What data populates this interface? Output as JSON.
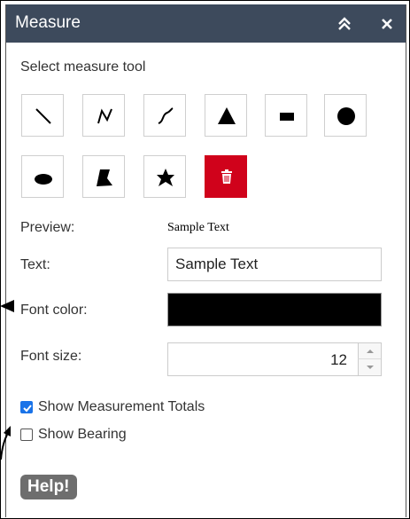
{
  "panel": {
    "title": "Measure",
    "collapse_icon": "chevron-double-up-icon",
    "close_icon": "close-icon",
    "header_color": "#3d4a5c"
  },
  "tools": {
    "label": "Select measure tool",
    "items": [
      {
        "name": "line",
        "icon": "line-icon"
      },
      {
        "name": "polyline",
        "icon": "polyline-icon"
      },
      {
        "name": "freehand-polyline",
        "icon": "freehand-line-icon"
      },
      {
        "name": "triangle",
        "icon": "triangle-icon"
      },
      {
        "name": "rectangle",
        "icon": "rectangle-icon"
      },
      {
        "name": "circle",
        "icon": "circle-icon"
      },
      {
        "name": "ellipse",
        "icon": "ellipse-icon"
      },
      {
        "name": "polygon",
        "icon": "polygon-icon"
      },
      {
        "name": "freehand-polygon",
        "icon": "freehand-polygon-icon"
      },
      {
        "name": "delete",
        "icon": "trash-icon",
        "color": "#d0021b"
      }
    ]
  },
  "form": {
    "preview_label": "Preview:",
    "preview_text": "Sample Text",
    "text_label": "Text:",
    "text_value": "Sample Text",
    "font_color_label": "Font color:",
    "font_color": "#000000",
    "font_size_label": "Font size:",
    "font_size_value": "12"
  },
  "options": {
    "show_totals_label": "Show Measurement Totals",
    "show_totals_checked": true,
    "show_bearing_label": "Show Bearing",
    "show_bearing_checked": false
  },
  "help": {
    "label": "Help!"
  }
}
